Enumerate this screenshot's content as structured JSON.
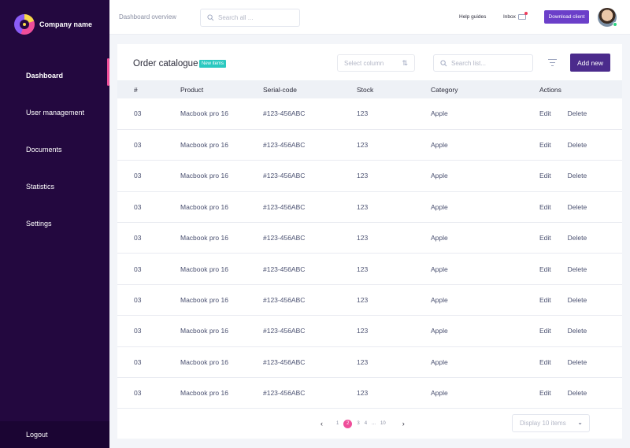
{
  "brand": {
    "name": "Company name"
  },
  "sidebar": {
    "items": [
      {
        "label": "Dashboard",
        "active": true
      },
      {
        "label": "User management",
        "active": false
      },
      {
        "label": "Documents",
        "active": false
      },
      {
        "label": "Statistics",
        "active": false
      },
      {
        "label": "Settings",
        "active": false
      }
    ],
    "logout_label": "Logout"
  },
  "topbar": {
    "breadcrumb": "Dashboard overview",
    "search_placeholder": "Search all ...",
    "help_label": "Help guides",
    "inbox_label": "Inbox",
    "download_label": "Download client"
  },
  "catalogue": {
    "title": "Order catalogue",
    "badge": "New items",
    "select_column_placeholder": "Select column",
    "search_placeholder": "Search list...",
    "add_label": "Add new",
    "columns": [
      "#",
      "Product",
      "Serial-code",
      "Stock",
      "Category",
      "Actions"
    ],
    "rows": [
      {
        "num": "03",
        "product": "Macbook pro 16",
        "serial": "#123-456ABC",
        "stock": "123",
        "category": "Apple"
      },
      {
        "num": "03",
        "product": "Macbook pro 16",
        "serial": "#123-456ABC",
        "stock": "123",
        "category": "Apple"
      },
      {
        "num": "03",
        "product": "Macbook pro 16",
        "serial": "#123-456ABC",
        "stock": "123",
        "category": "Apple"
      },
      {
        "num": "03",
        "product": "Macbook pro 16",
        "serial": "#123-456ABC",
        "stock": "123",
        "category": "Apple"
      },
      {
        "num": "03",
        "product": "Macbook pro 16",
        "serial": "#123-456ABC",
        "stock": "123",
        "category": "Apple"
      },
      {
        "num": "03",
        "product": "Macbook pro 16",
        "serial": "#123-456ABC",
        "stock": "123",
        "category": "Apple"
      },
      {
        "num": "03",
        "product": "Macbook pro 16",
        "serial": "#123-456ABC",
        "stock": "123",
        "category": "Apple"
      },
      {
        "num": "03",
        "product": "Macbook pro 16",
        "serial": "#123-456ABC",
        "stock": "123",
        "category": "Apple"
      },
      {
        "num": "03",
        "product": "Macbook pro 16",
        "serial": "#123-456ABC",
        "stock": "123",
        "category": "Apple"
      },
      {
        "num": "03",
        "product": "Macbook pro 16",
        "serial": "#123-456ABC",
        "stock": "123",
        "category": "Apple"
      }
    ],
    "edit_label": "Edit",
    "delete_label": "Delete"
  },
  "pagination": {
    "pages": [
      "1",
      "2",
      "3",
      "4",
      "...",
      "10"
    ],
    "current": "2",
    "display_label": "Display 10 items"
  },
  "colors": {
    "sidebar_bg": "#23083f",
    "accent_pink": "#ef4e9a",
    "primary_purple": "#4b2b8c",
    "badge_teal": "#2bc9c0"
  }
}
